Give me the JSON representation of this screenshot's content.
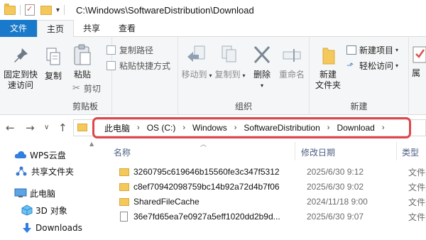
{
  "window": {
    "title": "C:\\Windows\\SoftwareDistribution\\Download"
  },
  "tabs": [
    {
      "label": "文件"
    },
    {
      "label": "主页"
    },
    {
      "label": "共享"
    },
    {
      "label": "查看"
    }
  ],
  "ribbon": {
    "clipboard": {
      "pin": "固定到快\n速访问",
      "copy": "复制",
      "paste": "粘贴",
      "copy_path": "复制路径",
      "paste_shortcut": "粘贴快捷方式",
      "cut": "剪切",
      "label": "剪贴板"
    },
    "organize": {
      "move_to": "移动到",
      "copy_to": "复制到",
      "delete": "删除",
      "rename": "重命名",
      "label": "组织"
    },
    "new": {
      "new_folder": "新建\n文件夹",
      "new_item": "新建项目",
      "easy_access": "轻松访问",
      "label": "新建"
    },
    "open": {
      "properties": "属"
    }
  },
  "address": {
    "crumbs": [
      "此电脑",
      "OS (C:)",
      "Windows",
      "SoftwareDistribution",
      "Download"
    ],
    "highlight_color": "#e0464a"
  },
  "nav_pane": {
    "items": [
      {
        "label": "WPS云盘",
        "icon": "cloud-icon"
      },
      {
        "label": "共享文件夹",
        "icon": "share-icon"
      },
      {
        "label": "此电脑",
        "icon": "computer-icon"
      },
      {
        "label": "3D 对象",
        "icon": "cube-icon"
      },
      {
        "label": "Downloads",
        "icon": "download-arrow-icon"
      }
    ]
  },
  "file_list": {
    "columns": {
      "name": "名称",
      "date": "修改日期",
      "type": "类型"
    },
    "rows": [
      {
        "name": "3260795c619646b15560fe3c347f5312",
        "date": "2025/6/30 9:12",
        "type": "文件夹",
        "kind": "folder"
      },
      {
        "name": "c8ef70942098759bc14b92a72d4b7f06",
        "date": "2025/6/30 9:02",
        "type": "文件夹",
        "kind": "folder"
      },
      {
        "name": "SharedFileCache",
        "date": "2024/11/18 9:00",
        "type": "文件夹",
        "kind": "folder"
      },
      {
        "name": "36e7fd65ea7e0927a5eff1020dd2b9d...",
        "date": "2025/6/30 9:07",
        "type": "文件",
        "kind": "file"
      }
    ]
  }
}
